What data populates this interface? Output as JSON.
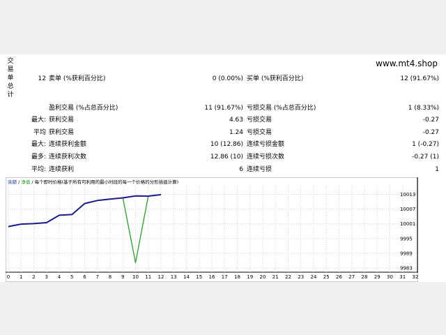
{
  "report": {
    "vertical_title": [
      "交",
      "易",
      "单",
      "总",
      "计"
    ],
    "site": "www.mt4.shop",
    "rows": [
      {
        "c1": "",
        "c2": "12",
        "c3": "卖单 (%获利百分比)",
        "c4": "0 (0.00%)",
        "c5": "买单 (%获利百分比)",
        "c6": "12 (91.67%)"
      },
      {
        "c1": "",
        "c2": "",
        "c3": "盈利交易 (%占总百分比)",
        "c4": "11 (91.67%)",
        "c5": "亏损交易 (%占总百分比)",
        "c6": "1 (8.33%)"
      },
      {
        "c1": "最大:",
        "c2": "",
        "c3": "获利交易",
        "c4": "4.63",
        "c5": "亏损交易",
        "c6": "-0.27"
      },
      {
        "c1": "平均",
        "c2": "",
        "c3": "获利交易",
        "c4": "1.24",
        "c5": "亏损交易",
        "c6": "-0.27"
      },
      {
        "c1": "最大:",
        "c2": "",
        "c3": "连续获利金额",
        "c4": "10 (12.86)",
        "c5": "连续亏损金额",
        "c6": "1 (-0.27)"
      },
      {
        "c1": "最多:",
        "c2": "",
        "c3": "连续获利次数",
        "c4": "12.86 (10)",
        "c5": "连续亏损次数",
        "c6": "-0.27 (1)"
      },
      {
        "c1": "平均:",
        "c2": "",
        "c3": "连续获利",
        "c4": "6",
        "c5": "连续亏损",
        "c6": "1"
      }
    ]
  },
  "chart_data": {
    "type": "line",
    "legend_text": [
      "余额",
      " / ",
      "净值",
      " / 每个即时价格(基于所有可利用的最小时段的每一个价格的分形插值计算)"
    ],
    "colors": {
      "balance": "#1a1a8c",
      "equity": "#2aa02a",
      "legend_balance": "#2233aa",
      "legend_equity": "#119911",
      "grid": "#d0d0d0"
    },
    "ylim": [
      9983,
      10016
    ],
    "yticks": [
      10013,
      10007,
      10001,
      9995,
      9989,
      9983
    ],
    "xlim": [
      0,
      32
    ],
    "xticks": [
      0,
      1,
      2,
      3,
      4,
      5,
      6,
      7,
      8,
      9,
      10,
      11,
      12,
      13,
      14,
      15,
      16,
      17,
      18,
      19,
      20,
      21,
      22,
      23,
      24,
      25,
      26,
      27,
      28,
      29,
      30,
      31,
      32
    ],
    "series": [
      {
        "key": "balance",
        "x": [
          0,
          1,
          2,
          3,
          4,
          5,
          6,
          7,
          8,
          9,
          10,
          11,
          12
        ],
        "y": [
          9999.9,
          10000.9,
          10001.1,
          10001.5,
          10004.5,
          10004.8,
          10009.3,
          10010.5,
          10011.1,
          10011.6,
          10012.4,
          10012.3,
          10012.9
        ]
      },
      {
        "key": "equity",
        "x": [
          9,
          10,
          11
        ],
        "y": [
          10011.6,
          9985.2,
          10012.4
        ]
      }
    ]
  }
}
